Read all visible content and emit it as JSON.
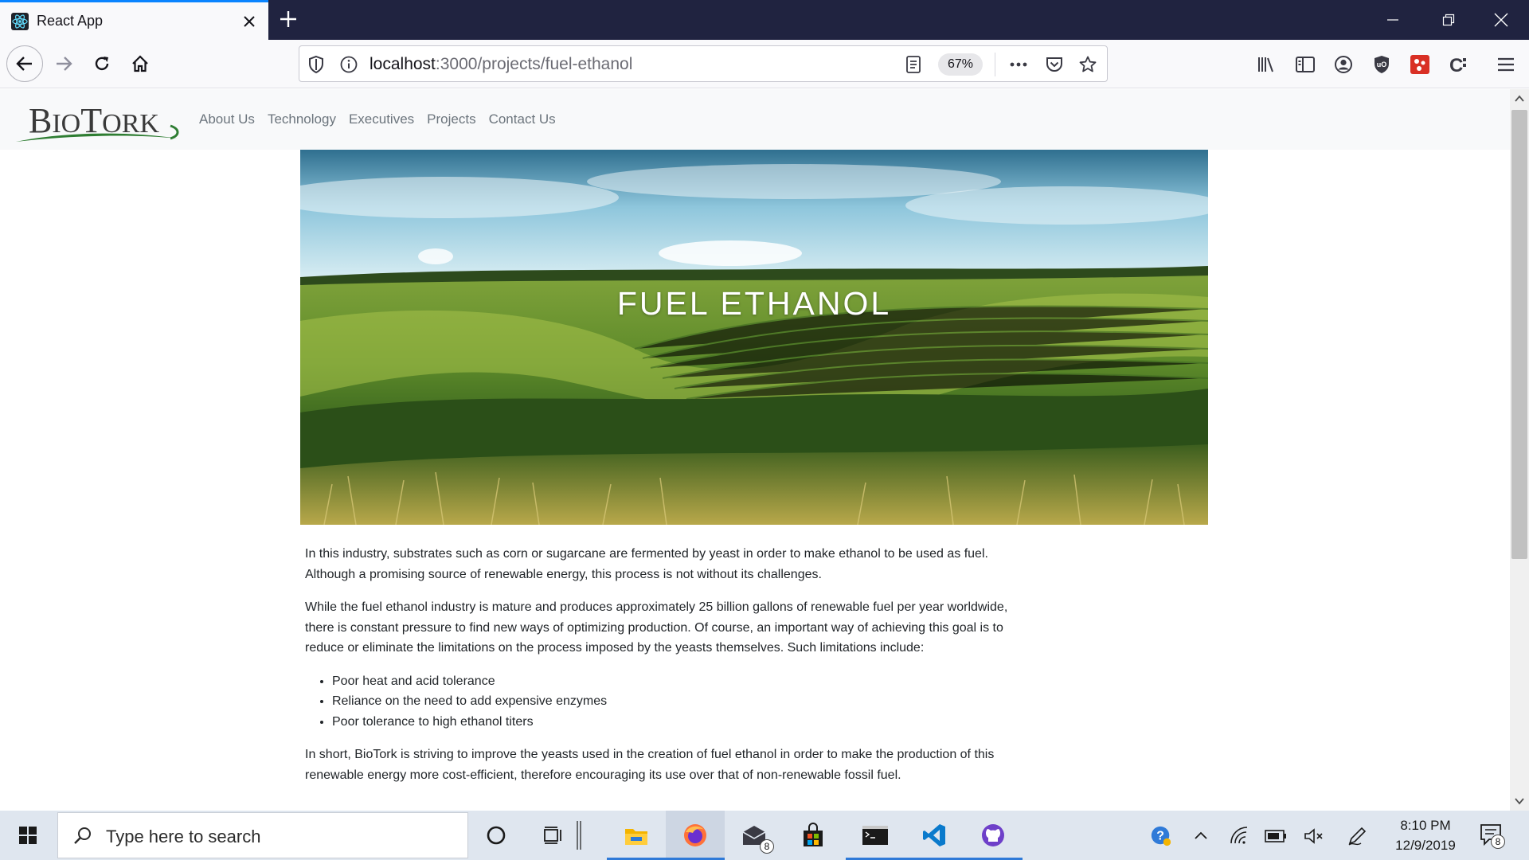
{
  "browser": {
    "tab": {
      "title": "React App",
      "favicon": "react-icon"
    },
    "url": {
      "host": "localhost",
      "path": ":3000/projects/fuel-ethanol"
    },
    "zoom": "67%",
    "toolbar_icons": [
      "library-icon",
      "sidebar-icon",
      "account-icon",
      "ublock-icon",
      "extension-red-icon",
      "extension-c-icon",
      "menu-icon"
    ]
  },
  "site": {
    "logo": {
      "text_big": "B",
      "text_small": "IO",
      "text_big2": "T",
      "text_small2": "ORK"
    },
    "nav": [
      {
        "label": "About Us"
      },
      {
        "label": "Technology"
      },
      {
        "label": "Executives"
      },
      {
        "label": "Projects"
      },
      {
        "label": "Contact Us"
      }
    ],
    "hero": {
      "title": "FUEL ETHANOL"
    },
    "article": {
      "p1": "In this industry, substrates such as corn or sugarcane are fermented by yeast in order to make ethanol to be used as fuel. Although a promising source of renewable energy, this process is not without its challenges.",
      "p2": "While the fuel ethanol industry is mature and produces approximately 25 billion gallons of renewable fuel per year worldwide, there is constant pressure to find new ways of optimizing production. Of course, an important way of achieving this goal is to reduce or eliminate the limitations on the process imposed by the yeasts themselves. Such limitations include:",
      "list": [
        {
          "text": "Poor heat and acid tolerance"
        },
        {
          "text": "Reliance on the need to add expensive enzymes"
        },
        {
          "text": "Poor tolerance to high ethanol titers"
        }
      ],
      "p3": "In short, BioTork is striving to improve the yeasts used in the creation of fuel ethanol in order to make the production of this renewable energy more cost-efficient, therefore encouraging its use over that of non-renewable fossil fuel."
    }
  },
  "taskbar": {
    "search_placeholder": "Type here to search",
    "mail_badge": "8",
    "notification_badge": "8",
    "time": "8:10 PM",
    "date": "12/9/2019"
  },
  "colors": {
    "titlebar": "#202340",
    "accent": "#0a84ff",
    "logo_green": "#2e7d32",
    "nav_text": "#6c757d",
    "taskbar": "#dfe6ef"
  }
}
